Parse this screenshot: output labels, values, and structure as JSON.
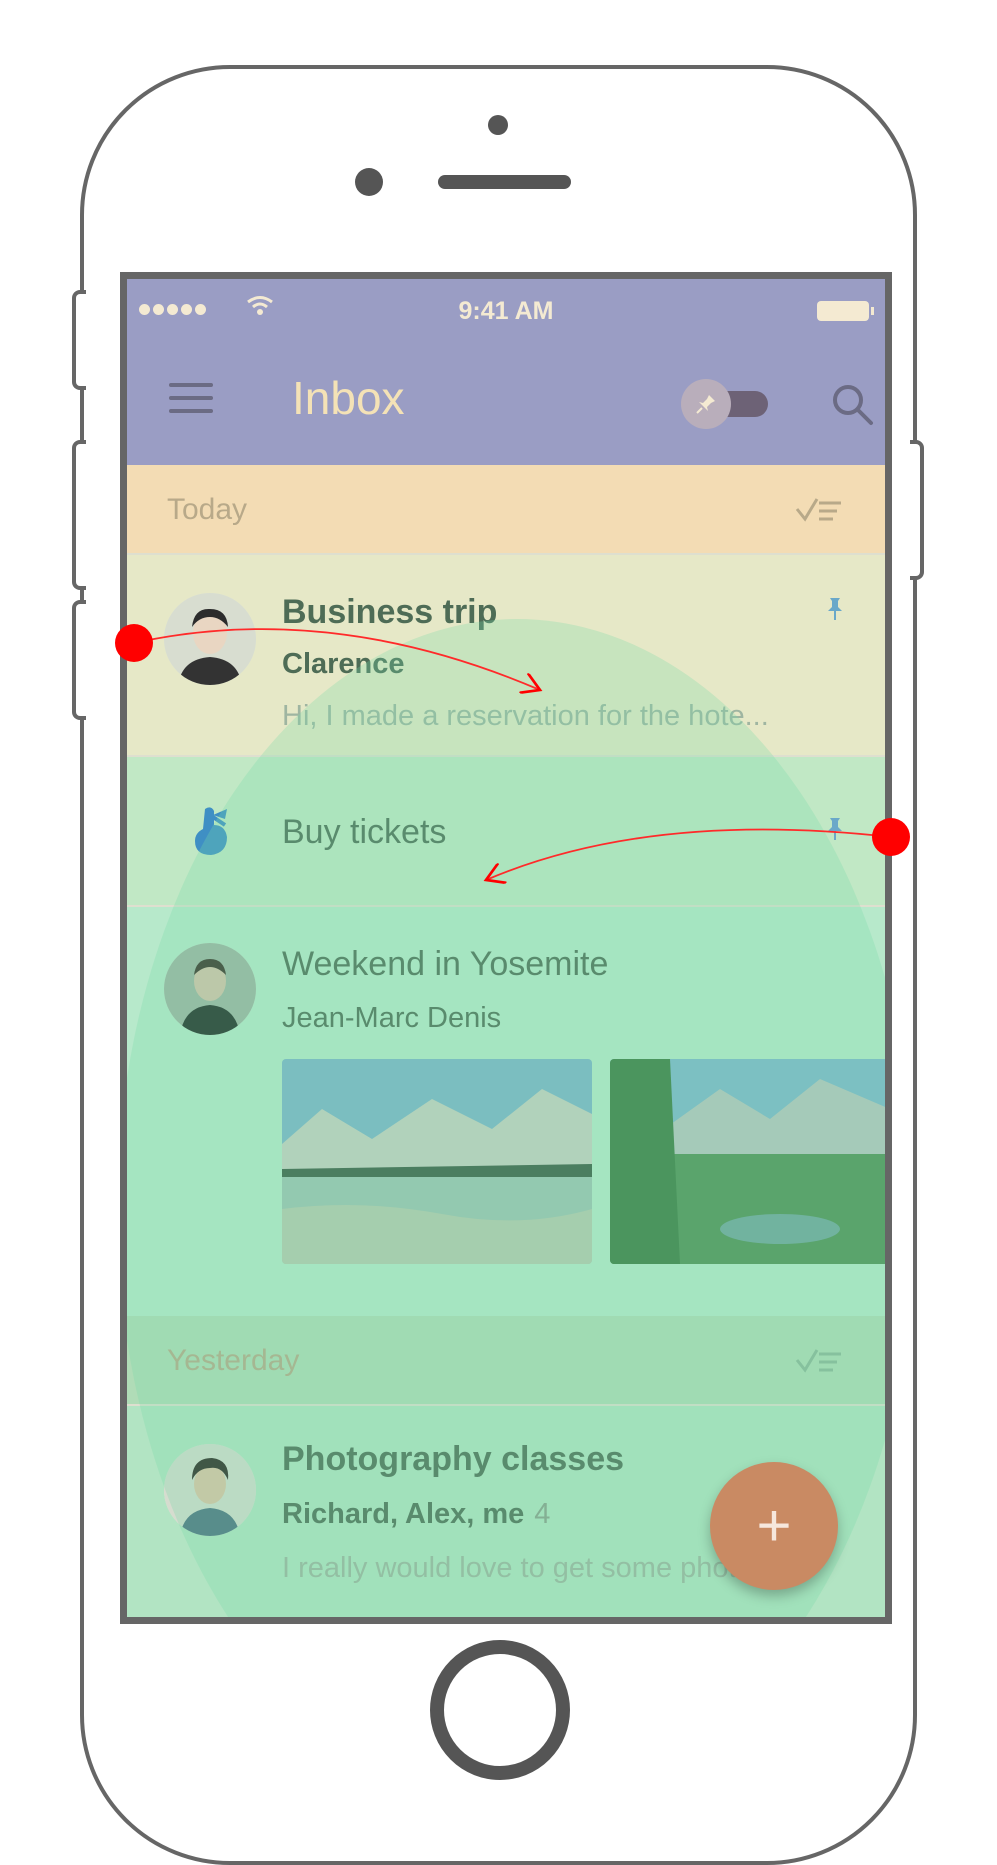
{
  "status_bar": {
    "time": "9:41 AM"
  },
  "app_bar": {
    "title": "Inbox"
  },
  "sections": {
    "today": "Today",
    "yesterday": "Yesterday"
  },
  "items": [
    {
      "subject": "Business trip",
      "sender": "Clarence",
      "snippet": "Hi, I made a reservation for the hote...",
      "pinned": true,
      "unread": true
    },
    {
      "subject": "Buy tickets",
      "type": "reminder",
      "pinned": true
    },
    {
      "subject": "Weekend in Yosemite",
      "sender": "Jean-Marc Denis",
      "attachments": 2
    },
    {
      "subject": "Photography classes",
      "sender": "Richard, Alex, me",
      "count": "4",
      "snippet": "I really would love to get some phot...",
      "unread": true
    }
  ],
  "fab": {
    "label": "+"
  },
  "icons": [
    "menu-icon",
    "pin-icon",
    "search-icon",
    "done-all-icon",
    "reminder-hand-icon",
    "wifi-icon",
    "battery-icon"
  ],
  "colors": {
    "app_bar": "#9a9dc4",
    "title": "#f4e2b6",
    "today_header": "#f3dcb4",
    "fab": "#c98a63",
    "gesture_marker": "#ff0000"
  }
}
